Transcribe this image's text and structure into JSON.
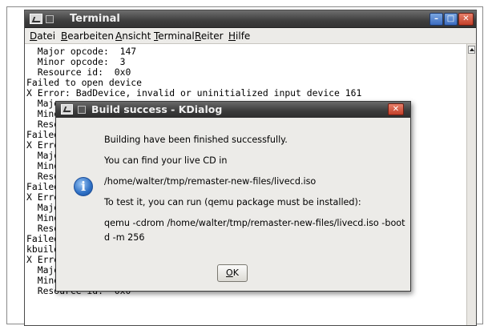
{
  "terminal": {
    "title": "Terminal",
    "menu": [
      {
        "label": "atei",
        "mnemonic": "D"
      },
      {
        "label": "earbeiten",
        "mnemonic": "B"
      },
      {
        "label": "nsicht",
        "mnemonic": "A"
      },
      {
        "label": "erminal",
        "mnemonic": "T"
      },
      {
        "label": "eiter",
        "mnemonic": "R"
      },
      {
        "label": "ilfe",
        "mnemonic": "H"
      }
    ],
    "lines": [
      "  Major opcode:  147",
      "  Minor opcode:  3",
      "  Resource id:  0x0",
      "Failed to open device",
      "X Error: BadDevice, invalid or uninitialized input device 161",
      "  Majo",
      "  Mino",
      "  Reso",
      "Failed",
      "X Erro",
      "  Majo",
      "  Mino",
      "  Reso",
      "Failed",
      "X Erro",
      "  Majo",
      "  Mino",
      "  Reso",
      "Failed",
      "kbuild",
      "X Erro",
      "  Major opcode:  147",
      "  Minor opcode:  3",
      "  Resource id:  0x0"
    ]
  },
  "dialog": {
    "title": "Build success - KDialog",
    "messages": [
      "Building have been finished successfully.",
      "You can find your live CD in",
      "/home/walter/tmp/remaster-new-files/livecd.iso",
      "To test it, you can run (qemu package must be installed):",
      "qemu -cdrom /home/walter/tmp/remaster-new-files/livecd.iso -boot",
      "d -m 256"
    ],
    "ok_mnemonic": "O",
    "ok_rest": "K",
    "close_glyph": "✕",
    "info_glyph": "i"
  },
  "window_buttons": {
    "minimize": "–",
    "maximize": "□",
    "close": "✕"
  }
}
